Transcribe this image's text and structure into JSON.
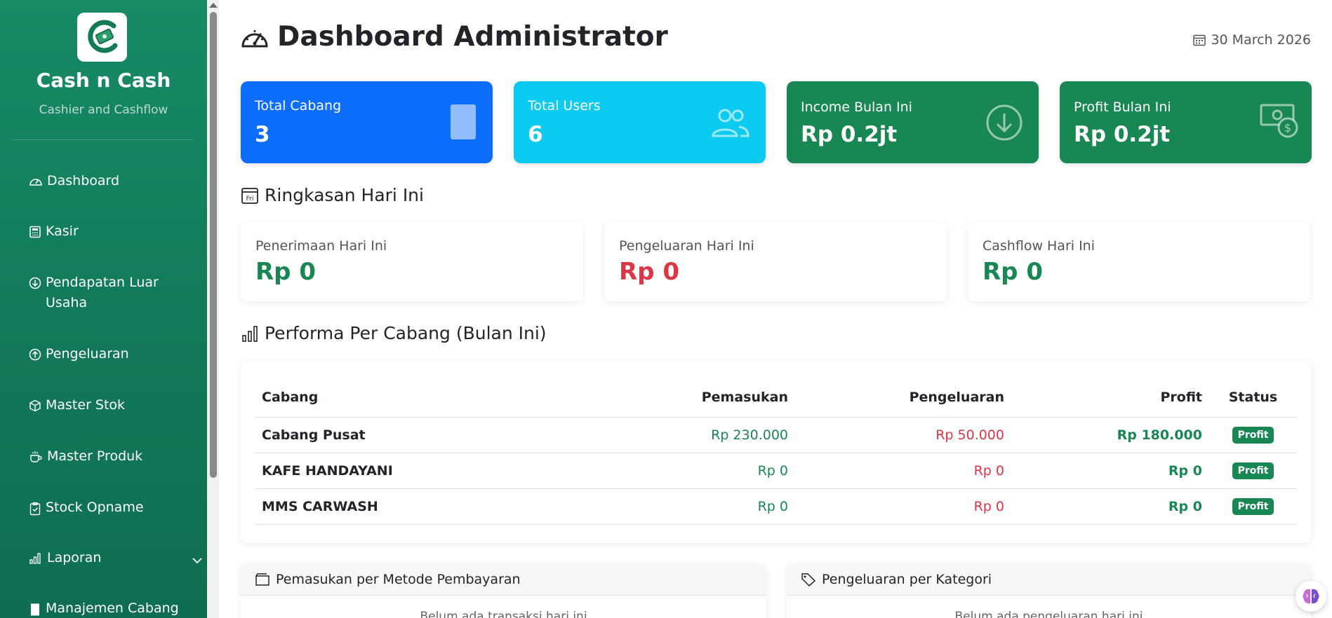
{
  "brand": {
    "title": "Cash n Cash",
    "subtitle": "Cashier and Cashflow"
  },
  "nav": {
    "dashboard": "Dashboard",
    "kasir": "Kasir",
    "pendapatan": "Pendapatan Luar Usaha",
    "pengeluaran": "Pengeluaran",
    "master_stok": "Master Stok",
    "master_produk": "Master Produk",
    "stock_opname": "Stock Opname",
    "laporan": "Laporan",
    "manajemen_cabang": "Manajemen Cabang"
  },
  "header": {
    "title": "Dashboard Administrator",
    "date": "30 March 2026"
  },
  "stats": {
    "cabang": {
      "label": "Total Cabang",
      "value": "3"
    },
    "users": {
      "label": "Total Users",
      "value": "6"
    },
    "income": {
      "label": "Income Bulan Ini",
      "value": "Rp 0.2jt"
    },
    "profit": {
      "label": "Profit Bulan Ini",
      "value": "Rp 0.2jt"
    }
  },
  "summary": {
    "title": "Ringkasan Hari Ini",
    "calendar_day": "Fri",
    "penerimaan": {
      "label": "Penerimaan Hari Ini",
      "value": "Rp 0"
    },
    "pengeluaran": {
      "label": "Pengeluaran Hari Ini",
      "value": "Rp 0"
    },
    "cashflow": {
      "label": "Cashflow Hari Ini",
      "value": "Rp 0"
    }
  },
  "performance": {
    "title": "Performa Per Cabang (Bulan Ini)",
    "headers": {
      "cabang": "Cabang",
      "pemasukan": "Pemasukan",
      "pengeluaran": "Pengeluaran",
      "profit": "Profit",
      "status": "Status"
    },
    "rows": [
      {
        "cabang": "Cabang Pusat",
        "pemasukan": "Rp 230.000",
        "pengeluaran": "Rp 50.000",
        "profit": "Rp 180.000",
        "status": "Profit"
      },
      {
        "cabang": "KAFE HANDAYANI",
        "pemasukan": "Rp 0",
        "pengeluaran": "Rp 0",
        "profit": "Rp 0",
        "status": "Profit"
      },
      {
        "cabang": "MMS CARWASH",
        "pemasukan": "Rp 0",
        "pengeluaran": "Rp 0",
        "profit": "Rp 0",
        "status": "Profit"
      }
    ]
  },
  "panels": {
    "metode": {
      "title": "Pemasukan per Metode Pembayaran",
      "empty": "Belum ada transaksi hari ini"
    },
    "kategori": {
      "title": "Pengeluaran per Kategori",
      "empty": "Belum ada pengeluaran hari ini"
    }
  },
  "colors": {
    "sidebar": "#178a66",
    "primary": "#0d6efd",
    "info": "#0dcaf0",
    "success": "#198754",
    "danger": "#dc3545"
  }
}
